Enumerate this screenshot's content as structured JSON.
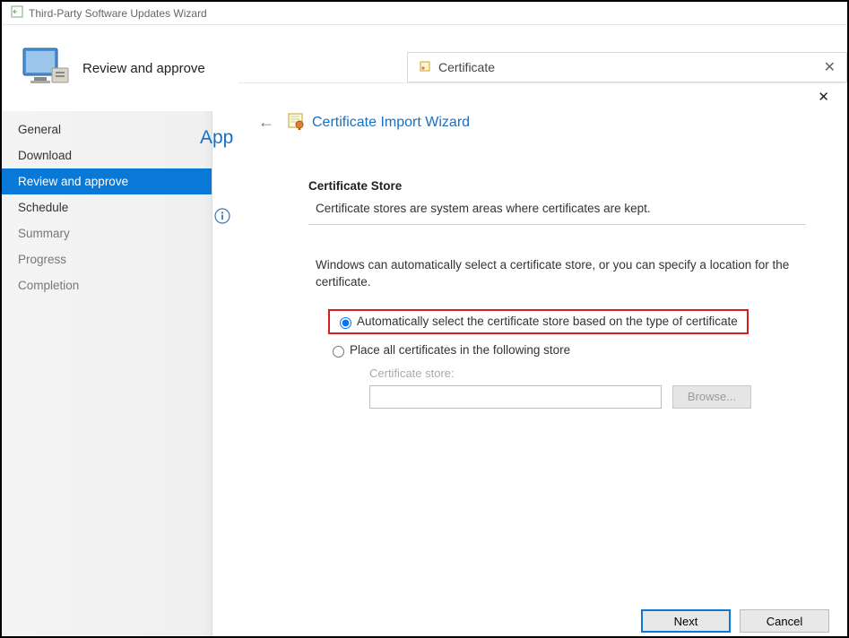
{
  "window": {
    "title": "Third-Party Software Updates Wizard",
    "page_title": "Review and approve"
  },
  "sidebar": {
    "items": [
      {
        "label": "General"
      },
      {
        "label": "Download"
      },
      {
        "label": "Review and approve"
      },
      {
        "label": "Schedule"
      },
      {
        "label": "Summary"
      },
      {
        "label": "Progress"
      },
      {
        "label": "Completion"
      }
    ]
  },
  "right_pane": {
    "heading_partial": "App"
  },
  "cert_window": {
    "title": "Certificate"
  },
  "wizard": {
    "heading": "Certificate Import Wizard",
    "section_title": "Certificate Store",
    "section_desc": "Certificate stores are system areas where certificates are kept.",
    "help_text": "Windows can automatically select a certificate store, or you can specify a location for the certificate.",
    "radio_auto": "Automatically select the certificate store based on the type of certificate",
    "radio_place": "Place all certificates in the following store",
    "store_label": "Certificate store:",
    "store_value": "",
    "browse_label": "Browse...",
    "next_label": "Next",
    "cancel_label": "Cancel"
  }
}
